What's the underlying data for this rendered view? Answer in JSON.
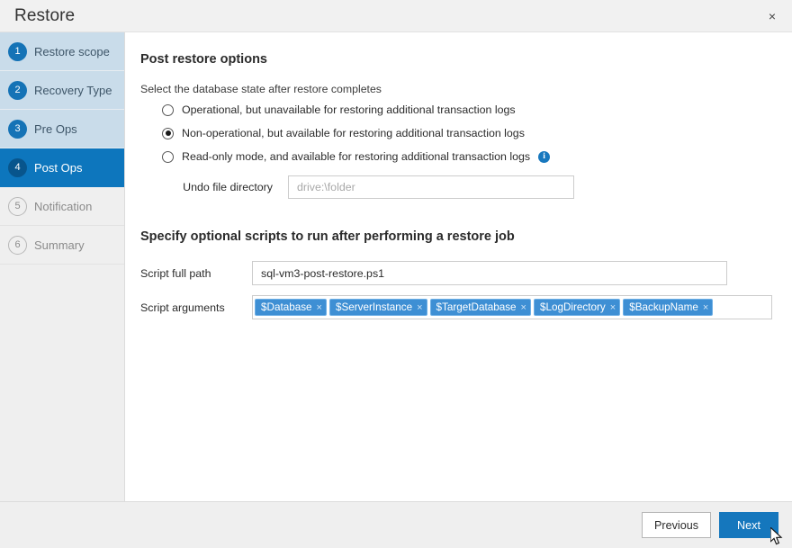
{
  "window": {
    "title": "Restore",
    "close_label": "×"
  },
  "sidebar": {
    "items": [
      {
        "num": "1",
        "label": "Restore scope",
        "state": "done"
      },
      {
        "num": "2",
        "label": "Recovery Type",
        "state": "done"
      },
      {
        "num": "3",
        "label": "Pre Ops",
        "state": "done"
      },
      {
        "num": "4",
        "label": "Post Ops",
        "state": "active"
      },
      {
        "num": "5",
        "label": "Notification",
        "state": "pending"
      },
      {
        "num": "6",
        "label": "Summary",
        "state": "pending"
      }
    ]
  },
  "main": {
    "post_restore": {
      "heading": "Post restore options",
      "hint": "Select the database state after restore completes",
      "options": [
        {
          "label": "Operational, but unavailable for restoring additional transaction logs",
          "checked": false,
          "info": false
        },
        {
          "label": "Non-operational, but available for restoring additional transaction logs",
          "checked": true,
          "info": false
        },
        {
          "label": "Read-only mode, and available for restoring additional transaction logs",
          "checked": false,
          "info": true
        }
      ],
      "info_icon_glyph": "i",
      "undo": {
        "label": "Undo file directory",
        "value": "",
        "placeholder": "drive:\\folder"
      }
    },
    "scripts": {
      "heading": "Specify optional scripts to run after performing a restore job",
      "script_path": {
        "label": "Script full path",
        "value": "sql-vm3-post-restore.ps1",
        "placeholder": ""
      },
      "script_args": {
        "label": "Script arguments",
        "tags": [
          "$Database",
          "$ServerInstance",
          "$TargetDatabase",
          "$LogDirectory",
          "$BackupName"
        ],
        "remove_glyph": "×",
        "input_value": ""
      }
    }
  },
  "footer": {
    "previous_label": "Previous",
    "next_label": "Next"
  },
  "colors": {
    "accent": "#1577bd",
    "active_step": "#0d76bd",
    "done_step_bg": "#c9dcea",
    "tag_bg": "#3e8fd4",
    "info_blue": "#1878be"
  }
}
